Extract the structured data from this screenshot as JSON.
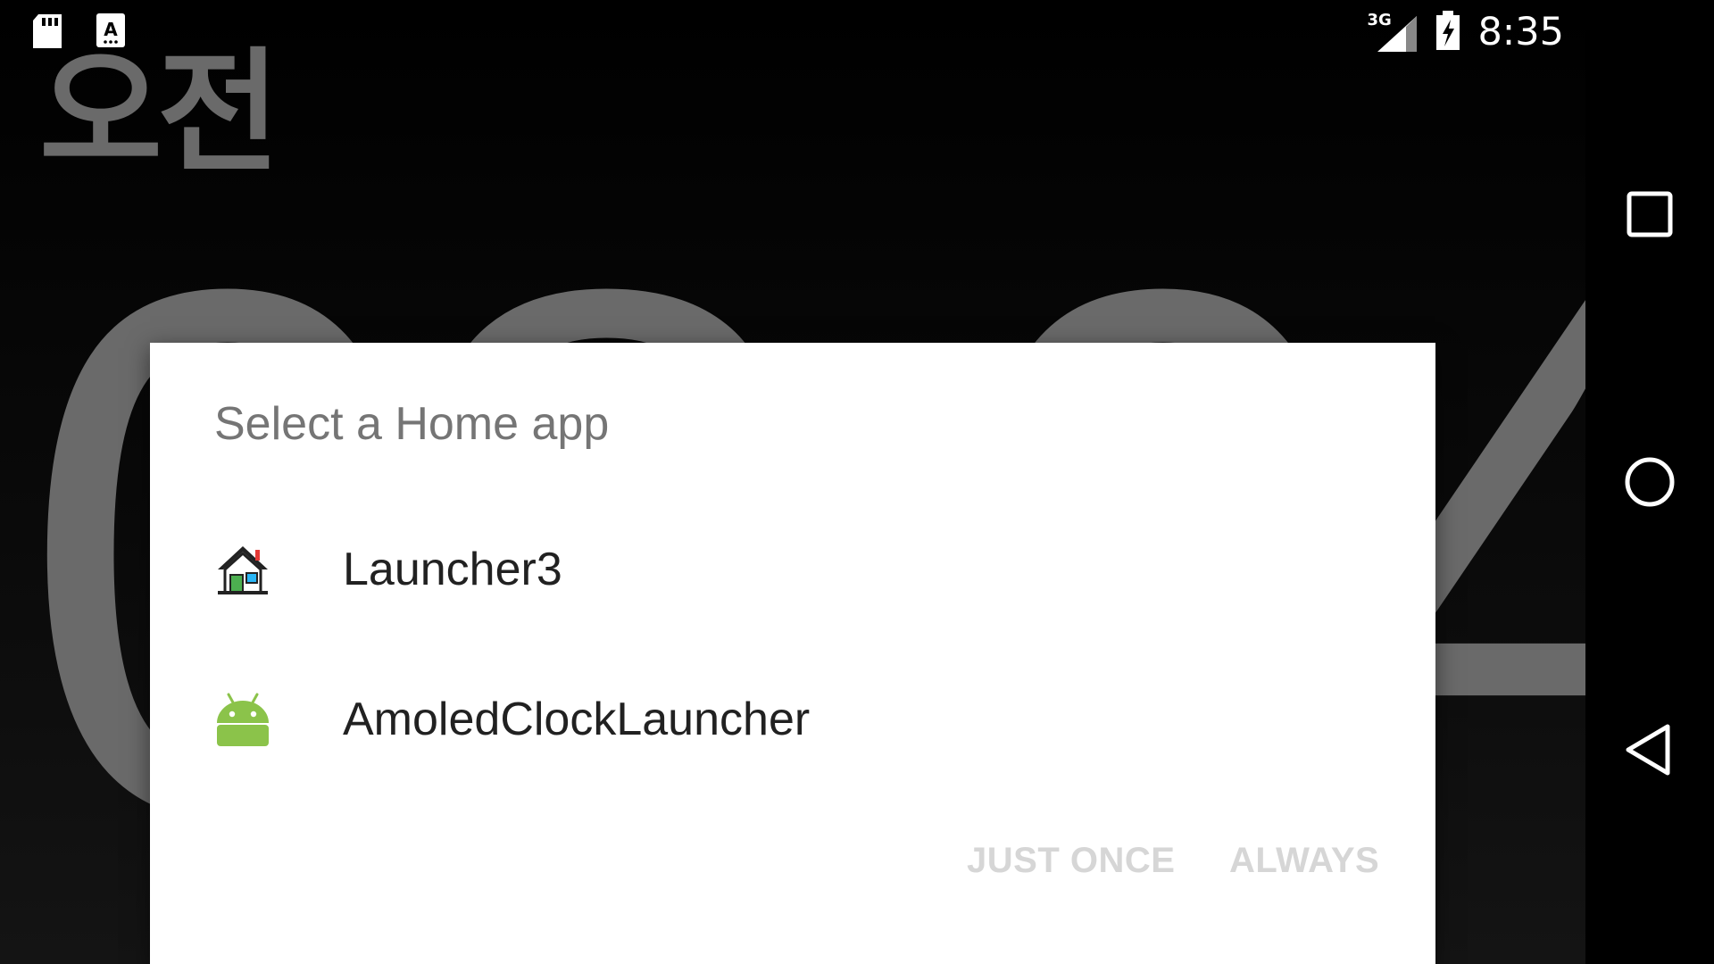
{
  "status_bar": {
    "time": "8:35",
    "network": "3G",
    "icons": [
      "sd-card-icon",
      "keyboard-icon",
      "signal-icon",
      "battery-charging-icon"
    ]
  },
  "background_clock": {
    "ampm": "오전",
    "time_digits": "08:04"
  },
  "dialog": {
    "title": "Select a Home app",
    "apps": [
      {
        "label": "Launcher3",
        "icon": "launcher3-house-icon"
      },
      {
        "label": "AmoledClockLauncher",
        "icon": "android-robot-icon"
      }
    ],
    "buttons": {
      "just_once": "JUST ONCE",
      "always": "ALWAYS"
    }
  },
  "nav_bar": {
    "icons": [
      "recents-square-icon",
      "home-circle-icon",
      "back-triangle-icon"
    ]
  },
  "colors": {
    "dialog_bg": "#ffffff",
    "title": "#757575",
    "item_text": "#212121",
    "disabled_button": "#d6d6d6",
    "clock_gray": "#6a6a6a",
    "android_green": "#8bc34a"
  }
}
